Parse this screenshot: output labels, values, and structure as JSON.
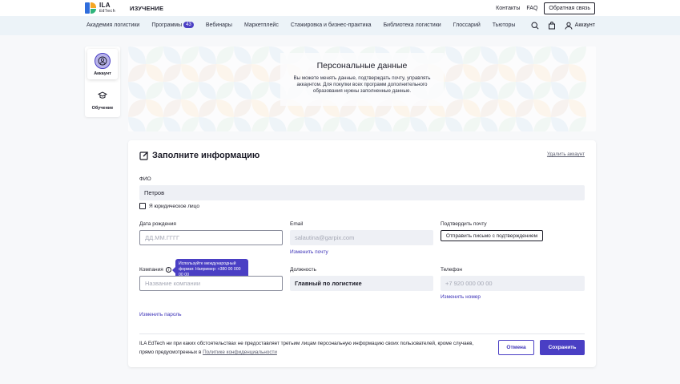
{
  "header": {
    "logo_line1": "ILA",
    "logo_line2": "EdTech",
    "section": "ИЗУЧЕНИЕ",
    "links": [
      "Контакты",
      "FAQ"
    ],
    "feedback_label": "Обратная связь"
  },
  "nav": {
    "items": [
      {
        "label": "Академия логистики"
      },
      {
        "label": "Программы",
        "badge": "43"
      },
      {
        "label": "Вебинары"
      },
      {
        "label": "Маркетплейс"
      },
      {
        "label": "Стажировка и бизнес-практика"
      },
      {
        "label": "Библиотека логистики"
      },
      {
        "label": "Глоссарий"
      },
      {
        "label": "Тьюторы"
      }
    ],
    "account_label": "Аккаунт",
    "icons": [
      "search-icon",
      "cart-icon",
      "user-icon"
    ]
  },
  "sidebar": {
    "items": [
      {
        "label": "Аккаунт",
        "icon": "account-icon",
        "active": true
      },
      {
        "label": "Обучение",
        "icon": "graduation-cap-icon",
        "active": false
      }
    ]
  },
  "hero": {
    "title": "Персональные данные",
    "description": "Вы можете менять данные, подтверждать почту, управлять аккаунтом. Для покупки всех программ дополнительного образования нужны заполненные данные."
  },
  "form": {
    "title": "Заполните информацию",
    "delete_account": "Удалить аккаунт",
    "fio_label": "ФИО",
    "fio_value": "Петров",
    "legal_entity_label": "Я юридическое лицо",
    "birth_label": "Дата рождения",
    "birth_placeholder": "ДД.ММ.ГГГГ",
    "email_label": "Email",
    "email_value": "salautina@garpix.com",
    "change_email": "Изменить почту",
    "confirm_email_label": "Подтвердить почту",
    "confirm_email_button": "Отправить письмо с подтверждением",
    "company_label": "Компания",
    "company_placeholder": "Название компании",
    "tooltip": "Используйте международный формат. Например: +380 00 000 00 00",
    "position_label": "Должность",
    "position_value": "Главный по логистике",
    "phone_label": "Телефон",
    "phone_placeholder": "+7 920 000 00 00",
    "change_phone": "Изменить номер",
    "change_password": "Изменить пароль",
    "footer_text": "ILA EdTech ни при каких обстоятельствах не предоставляет третьим лицам персональную информацию своих пользователей, кроме случаев, прямо предусмотренных в",
    "privacy_link": "Политике конфиденциальности",
    "cancel_label": "Отмена",
    "save_label": "Сохранить"
  },
  "colors": {
    "accent": "#4a3fc4",
    "nav_bg": "#ecf3f8",
    "page_bg": "#f7f8fa"
  }
}
